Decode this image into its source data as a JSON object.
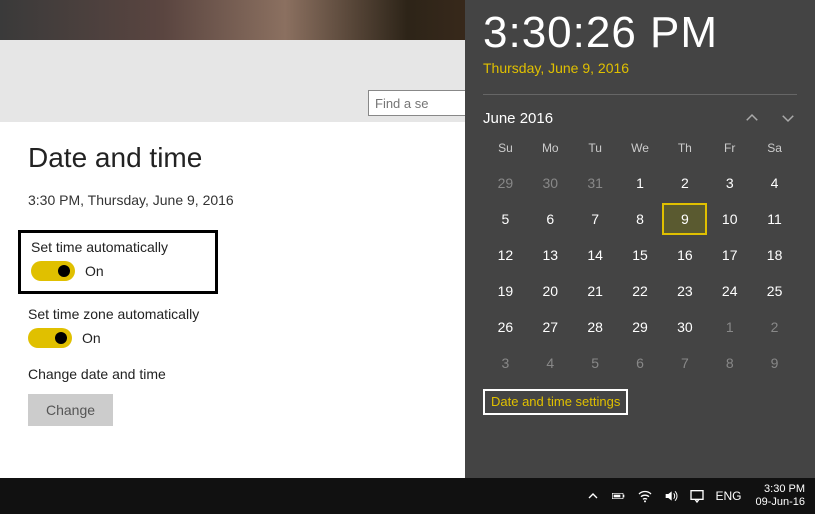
{
  "search": {
    "placeholder": "Find a se"
  },
  "settings": {
    "heading": "Date and time",
    "current": "3:30 PM, Thursday, June 9, 2016",
    "auto_time": {
      "label": "Set time automatically",
      "state": "On"
    },
    "auto_zone": {
      "label": "Set time zone automatically",
      "state": "On"
    },
    "change_label": "Change date and time",
    "change_button": "Change"
  },
  "flyout": {
    "time": "3:30:26 PM",
    "date": "Thursday, June 9, 2016",
    "month": "June 2016",
    "dow": [
      "Su",
      "Mo",
      "Tu",
      "We",
      "Th",
      "Fr",
      "Sa"
    ],
    "weeks": [
      [
        {
          "n": 29,
          "dim": true
        },
        {
          "n": 30,
          "dim": true
        },
        {
          "n": 31,
          "dim": true
        },
        {
          "n": 1
        },
        {
          "n": 2
        },
        {
          "n": 3
        },
        {
          "n": 4
        }
      ],
      [
        {
          "n": 5
        },
        {
          "n": 6
        },
        {
          "n": 7
        },
        {
          "n": 8
        },
        {
          "n": 9,
          "today": true
        },
        {
          "n": 10
        },
        {
          "n": 11
        }
      ],
      [
        {
          "n": 12
        },
        {
          "n": 13
        },
        {
          "n": 14
        },
        {
          "n": 15
        },
        {
          "n": 16
        },
        {
          "n": 17
        },
        {
          "n": 18
        }
      ],
      [
        {
          "n": 19
        },
        {
          "n": 20
        },
        {
          "n": 21
        },
        {
          "n": 22
        },
        {
          "n": 23
        },
        {
          "n": 24
        },
        {
          "n": 25
        }
      ],
      [
        {
          "n": 26
        },
        {
          "n": 27
        },
        {
          "n": 28
        },
        {
          "n": 29
        },
        {
          "n": 30
        },
        {
          "n": 1,
          "dim": true
        },
        {
          "n": 2,
          "dim": true
        }
      ],
      [
        {
          "n": 3,
          "dim": true
        },
        {
          "n": 4,
          "dim": true
        },
        {
          "n": 5,
          "dim": true
        },
        {
          "n": 6,
          "dim": true
        },
        {
          "n": 7,
          "dim": true
        },
        {
          "n": 8,
          "dim": true
        },
        {
          "n": 9,
          "dim": true
        }
      ]
    ],
    "settings_link": "Date and time settings"
  },
  "taskbar": {
    "lang": "ENG",
    "time": "3:30 PM",
    "date": "09-Jun-16"
  }
}
